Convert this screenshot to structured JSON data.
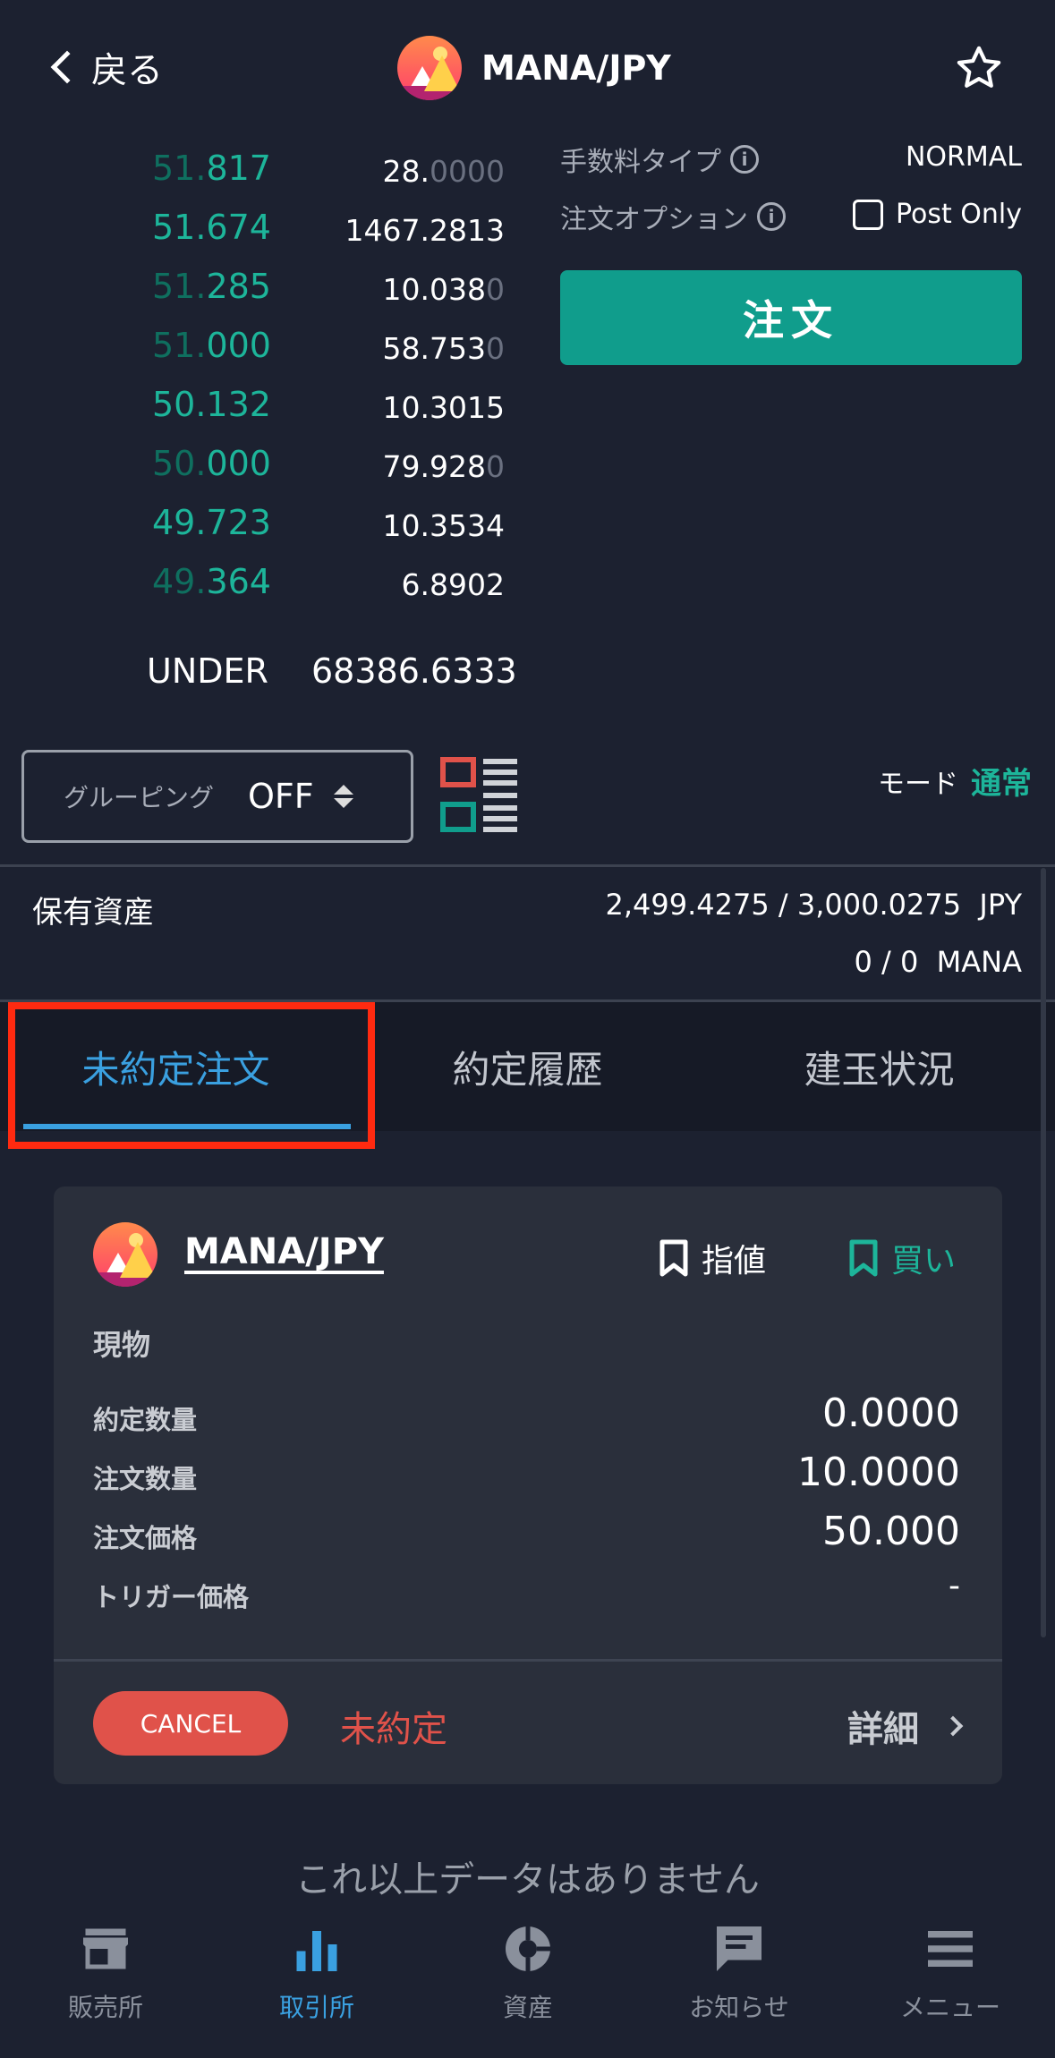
{
  "header": {
    "back_label": "戻る",
    "pair": "MANA/JPY"
  },
  "orderbook": {
    "rows": [
      {
        "price_dim": "51.",
        "price": "817",
        "qty": "28.",
        "qty_dim": "0000"
      },
      {
        "price_dim": "",
        "price": "51.674",
        "qty": "1467.2813",
        "qty_dim": ""
      },
      {
        "price_dim": "51.",
        "price": "285",
        "qty": "10.038",
        "qty_dim": "0"
      },
      {
        "price_dim": "51.",
        "price": "000",
        "qty": "58.753",
        "qty_dim": "0"
      },
      {
        "price_dim": "",
        "price": "50.132",
        "qty": "10.3015",
        "qty_dim": ""
      },
      {
        "price_dim": "50.",
        "price": "000",
        "qty": "79.928",
        "qty_dim": "0"
      },
      {
        "price_dim": "",
        "price": "49.723",
        "qty": "10.3534",
        "qty_dim": ""
      },
      {
        "price_dim": "49.",
        "price": "364",
        "qty": "6.8902",
        "qty_dim": ""
      }
    ],
    "under_label": "UNDER",
    "under_value": "68386.6333"
  },
  "order_panel": {
    "fee_type_label": "手数料タイプ",
    "fee_type_value": "NORMAL",
    "option_label": "注文オプション",
    "post_only_label": "Post Only",
    "order_button": "注文"
  },
  "controls": {
    "grouping_label": "グルーピング",
    "grouping_value": "OFF",
    "mode_label": "モード",
    "mode_value": "通常"
  },
  "assets": {
    "label": "保有資産",
    "jpy": "2,499.4275 / 3,000.0275  JPY",
    "mana": "0 / 0  MANA"
  },
  "tabs": [
    "未約定注文",
    "約定履歴",
    "建玉状況"
  ],
  "order_card": {
    "pair": "MANA/JPY",
    "order_type": "指値",
    "side": "買い",
    "product": "現物",
    "fields": [
      {
        "label": "約定数量",
        "value": "0.0000"
      },
      {
        "label": "注文数量",
        "value": "10.0000"
      },
      {
        "label": "注文価格",
        "value": "50.000"
      },
      {
        "label": "トリガー価格",
        "value": "-"
      }
    ],
    "cancel_label": "CANCEL",
    "status": "未約定",
    "details_label": "詳細"
  },
  "no_more_data": "これ以上データはありません",
  "bottom_nav": [
    "販売所",
    "取引所",
    "資産",
    "お知らせ",
    "メニュー"
  ],
  "colors": {
    "background": "#1c2130",
    "accent_green": "#1db59a",
    "accent_blue": "#3aa0e0",
    "danger_red": "#e0524a",
    "highlight_red": "#ff2a10"
  }
}
